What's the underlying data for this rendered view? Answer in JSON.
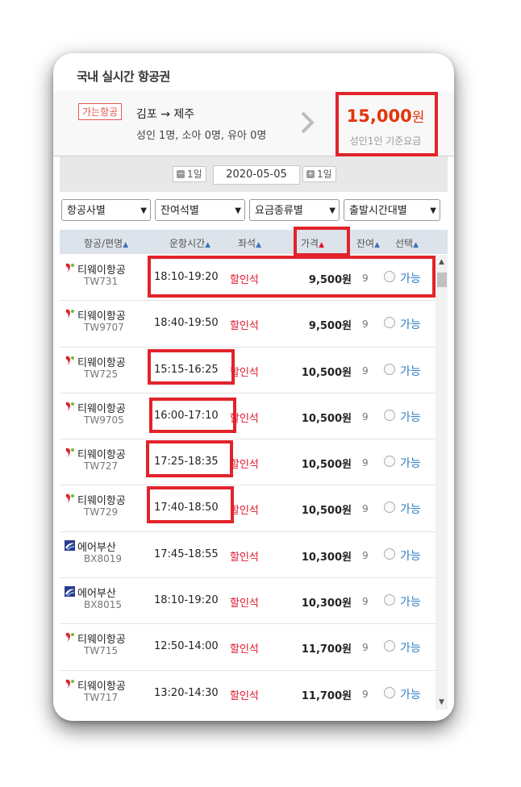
{
  "header": {
    "title": "국내 실시간 항공권"
  },
  "route": {
    "airline_chip": "가는항공",
    "route": "김포 → 제주",
    "passengers": "성인 1명, 소아 0명, 유아 0명",
    "price": "15,000",
    "price_unit": "원",
    "price_note": "성인1인 기준요금"
  },
  "date_nav": {
    "prev": "1일",
    "date": "2020-05-05",
    "next": "1일"
  },
  "filters": [
    "항공사별",
    "잔여석별",
    "요금종류별",
    "출발시간대별"
  ],
  "columns": [
    "항공/편명",
    "운항시간",
    "좌석",
    "가격",
    "잔여",
    "선택"
  ],
  "flights": [
    {
      "airline": "티웨이항공",
      "flight": "TW731",
      "time": "18:10-19:20",
      "seat": "할인석",
      "fare": "9,500원",
      "left": "9",
      "select": "가능"
    },
    {
      "airline": "티웨이항공",
      "flight": "TW9707",
      "time": "18:40-19:50",
      "seat": "할인석",
      "fare": "9,500원",
      "left": "9",
      "select": "가능"
    },
    {
      "airline": "티웨이항공",
      "flight": "TW725",
      "time": "15:15-16:25",
      "seat": "할인석",
      "fare": "10,500원",
      "left": "9",
      "select": "가능"
    },
    {
      "airline": "티웨이항공",
      "flight": "TW9705",
      "time": "16:00-17:10",
      "seat": "할인석",
      "fare": "10,500원",
      "left": "9",
      "select": "가능"
    },
    {
      "airline": "티웨이항공",
      "flight": "TW727",
      "time": "17:25-18:35",
      "seat": "할인석",
      "fare": "10,500원",
      "left": "9",
      "select": "가능"
    },
    {
      "airline": "티웨이항공",
      "flight": "TW729",
      "time": "17:40-18:50",
      "seat": "할인석",
      "fare": "10,500원",
      "left": "9",
      "select": "가능"
    },
    {
      "airline": "에어부산",
      "flight": "BX8019",
      "time": "17:45-18:55",
      "seat": "할인석",
      "fare": "10,300원",
      "left": "9",
      "select": "가능"
    },
    {
      "airline": "에어부산",
      "flight": "BX8015",
      "time": "18:10-19:20",
      "seat": "할인석",
      "fare": "10,300원",
      "left": "9",
      "select": "가능"
    },
    {
      "airline": "티웨이항공",
      "flight": "TW715",
      "time": "12:50-14:00",
      "seat": "할인석",
      "fare": "11,700원",
      "left": "9",
      "select": "가능"
    },
    {
      "airline": "티웨이항공",
      "flight": "TW717",
      "time": "13:20-14:30",
      "seat": "할인석",
      "fare": "11,700원",
      "left": "9",
      "select": "가능"
    }
  ],
  "colors": {
    "highlight": "#e2232b",
    "price": "#e2340c",
    "seat": "#e0162b",
    "link": "#2c7ec4",
    "tway": "#d7262e",
    "airbusan": "#2a3c8f"
  },
  "icons": {
    "tway_logo": "tway-logo-icon",
    "airbusan_logo": "airbusan-logo-icon"
  }
}
